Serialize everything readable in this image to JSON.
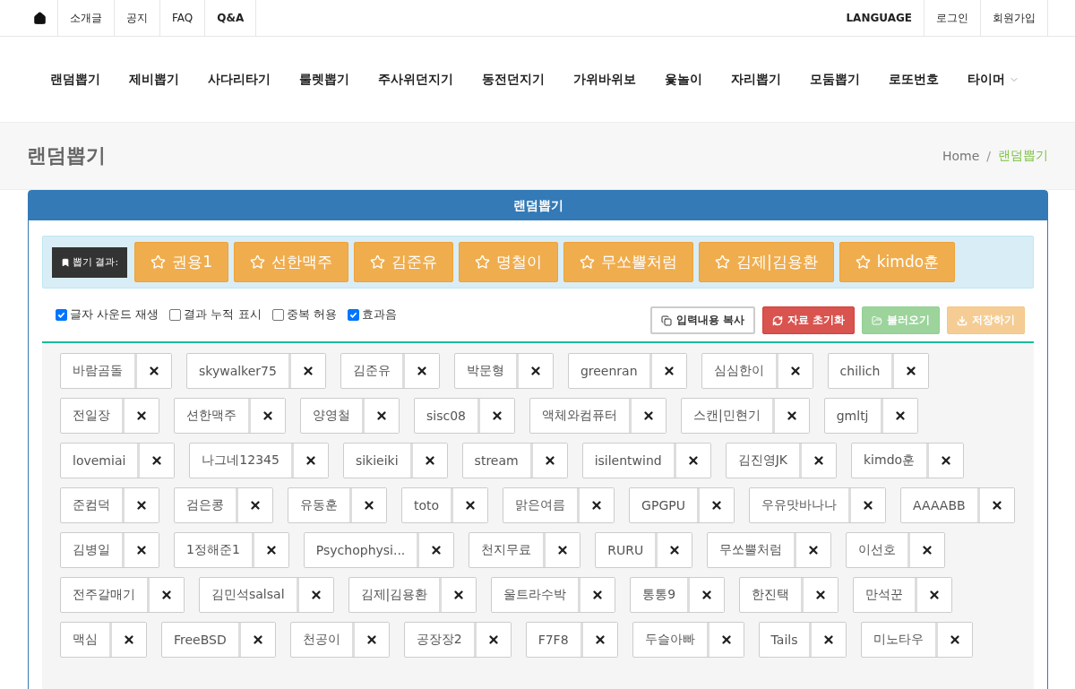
{
  "top_bar": {
    "left": [
      "소개글",
      "공지",
      "FAQ",
      "Q&A"
    ],
    "right": [
      "LANGUAGE",
      "로그인",
      "회원가입"
    ]
  },
  "nav": [
    {
      "label": "랜덤뽑기",
      "dropdown": false
    },
    {
      "label": "제비뽑기",
      "dropdown": false
    },
    {
      "label": "사다리타기",
      "dropdown": false
    },
    {
      "label": "룰렛뽑기",
      "dropdown": false
    },
    {
      "label": "주사위던지기",
      "dropdown": false
    },
    {
      "label": "동전던지기",
      "dropdown": false
    },
    {
      "label": "가위바위보",
      "dropdown": false
    },
    {
      "label": "윷놀이",
      "dropdown": false
    },
    {
      "label": "자리뽑기",
      "dropdown": false
    },
    {
      "label": "모둠뽑기",
      "dropdown": false
    },
    {
      "label": "로또번호",
      "dropdown": false
    },
    {
      "label": "타이머",
      "dropdown": true
    }
  ],
  "page_title": "랜덤뽑기",
  "breadcrumb": [
    "Home",
    "랜덤뽑기"
  ],
  "breadcrumb_separator": "/",
  "panel": {
    "title": "랜덤뽑기",
    "result_label": "뽑기 결과:",
    "results": [
      "권용1",
      "선한맥주",
      "김준유",
      "명철이",
      "무쏘뿔처럼",
      "김제|김용환",
      "kimdo훈"
    ],
    "options": [
      {
        "label": "글자 사운드 재생",
        "checked": true
      },
      {
        "label": "결과 누적 표시",
        "checked": false
      },
      {
        "label": "중복 허용",
        "checked": false
      },
      {
        "label": "효과음",
        "checked": true
      }
    ],
    "buttons": [
      {
        "label": "입력내용 복사",
        "kind": "copy",
        "disabled": false
      },
      {
        "label": "자료 초기화",
        "kind": "reset",
        "disabled": false
      },
      {
        "label": "불러오기",
        "kind": "load",
        "disabled": true
      },
      {
        "label": "저장하기",
        "kind": "save",
        "disabled": true
      }
    ],
    "names": [
      "바람곰돌",
      "skywalker75",
      "김준유",
      "박문형",
      "greenran",
      "심심한이",
      "chilich",
      "전일장",
      "션한맥주",
      "양영철",
      "sisc08",
      "액체와컴퓨터",
      "스캔|민현기",
      "gmltj",
      "lovemiai",
      "나그네12345",
      "sikieiki",
      "stream",
      "isilentwind",
      "김진영JK",
      "kimdo훈",
      "준컴덕",
      "검은콩",
      "유동훈",
      "toto",
      "맑은여름",
      "GPGPU",
      "우유맛바나나",
      "AAAABB",
      "김병일",
      "1정해준1",
      "Psychophysi...",
      "천지무료",
      "RURU",
      "무쏘뿔처럼",
      "이선호",
      "전주갈매기",
      "김민석salsal",
      "김제|김용환",
      "울트라수박",
      "통통9",
      "한진택",
      "만석꾼",
      "맥심",
      "FreeBSD",
      "천공이",
      "공장장2",
      "F7F8",
      "두슬아빠",
      "Tails",
      "미노타우"
    ]
  }
}
